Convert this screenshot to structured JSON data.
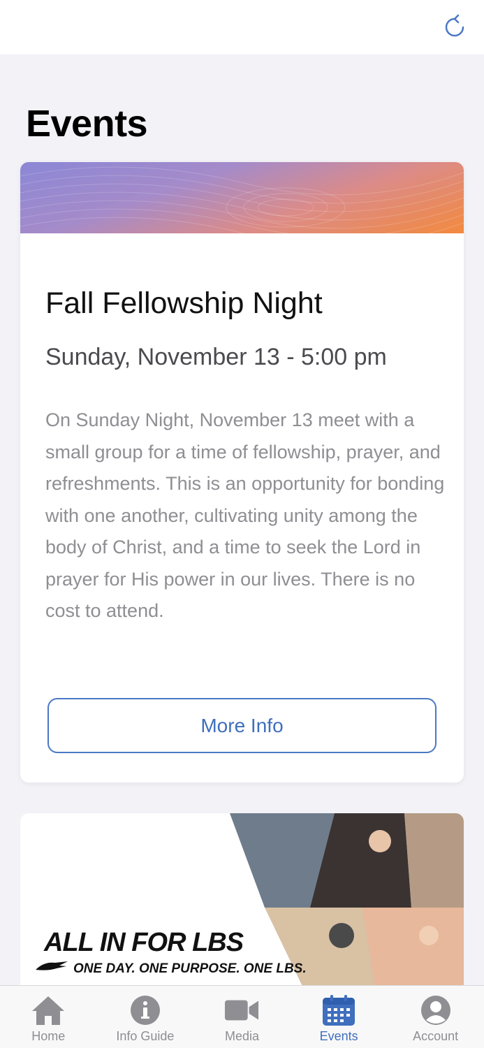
{
  "header": {
    "refresh_icon": "refresh-icon"
  },
  "page": {
    "title": "Events"
  },
  "event": {
    "title": "Fall Fellowship Night",
    "date": "Sunday, November 13 - 5:00 pm",
    "description": "On Sunday Night, November 13 meet with a small group for a time of fellowship, prayer, and refreshments. This is an opportunity for bonding with one another, cultivating unity among the body of Christ, and a time to seek the Lord in prayer for His power in our lives. There is no cost to attend.",
    "button_label": "More Info"
  },
  "event2": {
    "headline": "ALL IN FOR LBS",
    "tagline": "ONE DAY. ONE PURPOSE. ONE LBS."
  },
  "tabbar": {
    "items": [
      {
        "label": "Home",
        "icon": "home-icon"
      },
      {
        "label": "Info Guide",
        "icon": "info-icon"
      },
      {
        "label": "Media",
        "icon": "video-icon"
      },
      {
        "label": "Events",
        "icon": "calendar-icon",
        "active": true
      },
      {
        "label": "Account",
        "icon": "account-icon"
      }
    ]
  },
  "colors": {
    "accent": "#3f6fbd",
    "background": "#f2f2f7",
    "inactive": "#8e8e93"
  }
}
